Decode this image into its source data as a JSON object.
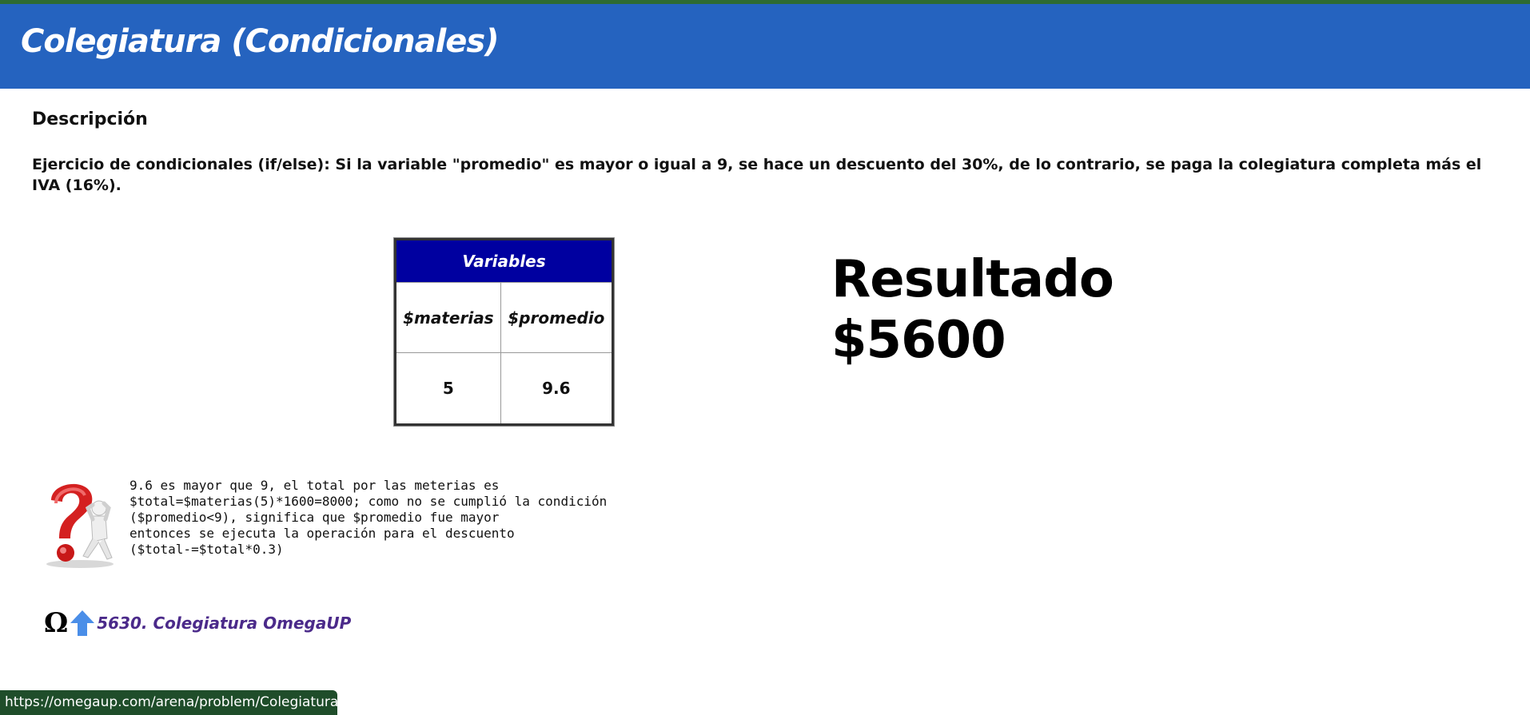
{
  "colors": {
    "header_bg": "#2563bf",
    "table_header_bg": "#0000a0",
    "link_color": "#4b2a8a",
    "status_bar_bg": "#1f4d2a"
  },
  "header": {
    "title": "Colegiatura (Condicionales)"
  },
  "description": {
    "heading": "Descripción",
    "text": "Ejercicio de condicionales (if/else): Si la variable \"promedio\" es mayor o igual a 9, se hace un descuento del 30%, de lo contrario, se paga la colegiatura completa más el IVA (16%)."
  },
  "variables_table": {
    "title": "Variables",
    "columns": [
      "$materias",
      "$promedio"
    ],
    "values": [
      "5",
      "9.6"
    ]
  },
  "result": {
    "label": "Resultado",
    "value": "$5600"
  },
  "explanation": {
    "lines": [
      "9.6 es mayor que 9, el total por las meterias es",
      "$total=$materias(5)*1600=8000; como no se cumplió la condición",
      "($promedio<9), significa que $promedio fue mayor",
      "entonces se ejecuta la operación para el descuento",
      "($total-=$total*0.3)"
    ]
  },
  "problem_link": {
    "icons": [
      "omega-icon",
      "up-arrow-icon"
    ],
    "label": "5630. Colegiatura OmegaUP"
  },
  "status_bar": {
    "url": "https://omegaup.com/arena/problem/Colegiatura/"
  }
}
